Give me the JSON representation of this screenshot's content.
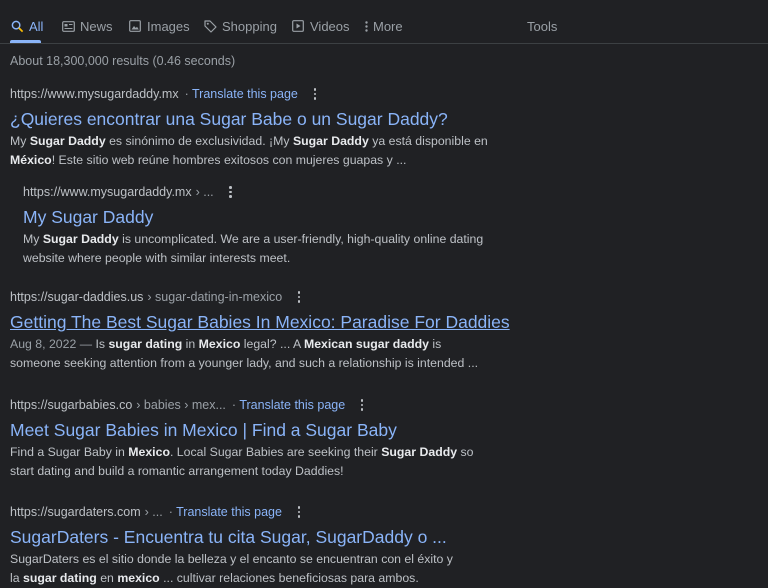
{
  "tabs": [
    {
      "label": "All",
      "icon": "search-icon",
      "active": true
    },
    {
      "label": "News",
      "icon": "news-icon"
    },
    {
      "label": "Images",
      "icon": "image-icon"
    },
    {
      "label": "Shopping",
      "icon": "tag-icon"
    },
    {
      "label": "Videos",
      "icon": "play-icon"
    },
    {
      "label": "More",
      "icon": "kebab-icon"
    }
  ],
  "tools_label": "Tools",
  "stats": "About 18,300,000 results (0.46 seconds)",
  "results": [
    {
      "url": "https://www.mysugardaddy.mx",
      "path": "",
      "translate": "Translate this page",
      "title": "¿Quieres encontrar una Sugar Babe o un Sugar Daddy?",
      "snippet": [
        {
          "t": "My "
        },
        {
          "t": "Sugar Daddy",
          "b": true
        },
        {
          "t": " es sinónimo de exclusividad. ¡My "
        },
        {
          "t": "Sugar Daddy",
          "b": true
        },
        {
          "t": " ya está disponible en "
        },
        {
          "t": "México",
          "b": true
        },
        {
          "t": "! Este sitio web reúne hombres exitosos con mujeres guapas y ..."
        }
      ]
    },
    {
      "url": "https://www.mysugardaddy.mx",
      "path": "› ...",
      "translate": "",
      "title": "My Sugar Daddy",
      "snippet": [
        {
          "t": "My "
        },
        {
          "t": "Sugar Daddy",
          "b": true
        },
        {
          "t": " is uncomplicated. We are a user-friendly, high-quality online dating website where people with similar interests meet."
        }
      ]
    },
    {
      "url": "https://sugar-daddies.us",
      "path": "› sugar-dating-in-mexico",
      "translate": "",
      "title": "Getting The Best Sugar Babies In Mexico: Paradise For Daddies",
      "date": "Aug 8, 2022 — ",
      "snippet": [
        {
          "t": "Is "
        },
        {
          "t": "sugar dating",
          "b": true
        },
        {
          "t": " in "
        },
        {
          "t": "Mexico",
          "b": true
        },
        {
          "t": " legal? ... A "
        },
        {
          "t": "Mexican sugar daddy",
          "b": true
        },
        {
          "t": " is someone seeking attention from a younger lady, and such a relationship is intended ..."
        }
      ]
    },
    {
      "url": "https://sugarbabies.co",
      "path": "› babies › mex...",
      "translate": "Translate this page",
      "title": "Meet Sugar Babies in Mexico | Find a Sugar Baby",
      "snippet": [
        {
          "t": "Find a Sugar Baby in "
        },
        {
          "t": "Mexico",
          "b": true
        },
        {
          "t": ". Local Sugar Babies are seeking their "
        },
        {
          "t": "Sugar Daddy",
          "b": true
        },
        {
          "t": " so start dating and build a romantic arrangement today Daddies!"
        }
      ]
    },
    {
      "url": "https://sugardaters.com",
      "path": "› ...",
      "translate": "Translate this page",
      "title": "SugarDaters - Encuentra tu cita Sugar, SugarDaddy o ...",
      "snippet": [
        {
          "t": "SugarDaters es el sitio donde la belleza y el encanto se encuentran con el éxito y la "
        },
        {
          "t": "sugar dating",
          "b": true
        },
        {
          "t": " en "
        },
        {
          "t": "mexico",
          "b": true
        },
        {
          "t": " ... cultivar relaciones beneficiosas para ambos."
        }
      ]
    }
  ],
  "colors": {
    "background": "#202124",
    "link": "#8ab4f8",
    "text": "#bdc1c6",
    "muted": "#9aa0a6"
  }
}
